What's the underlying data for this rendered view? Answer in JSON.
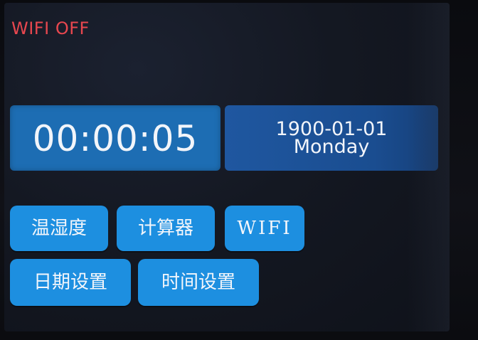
{
  "status": {
    "wifi": "WIFI OFF"
  },
  "clock": {
    "time": "00:00:05",
    "date": "1900-01-01",
    "weekday": "Monday"
  },
  "buttons": {
    "temp_humidity": "温湿度",
    "calculator": "计算器",
    "wifi": "WIFI",
    "date_settings": "日期设置",
    "time_settings": "时间设置"
  },
  "colors": {
    "wifi_off": "#e8474f",
    "time_panel": "#1d6db3",
    "date_panel": "#1f57a0",
    "button": "#1d8fe0",
    "text": "#f2f5fa"
  }
}
